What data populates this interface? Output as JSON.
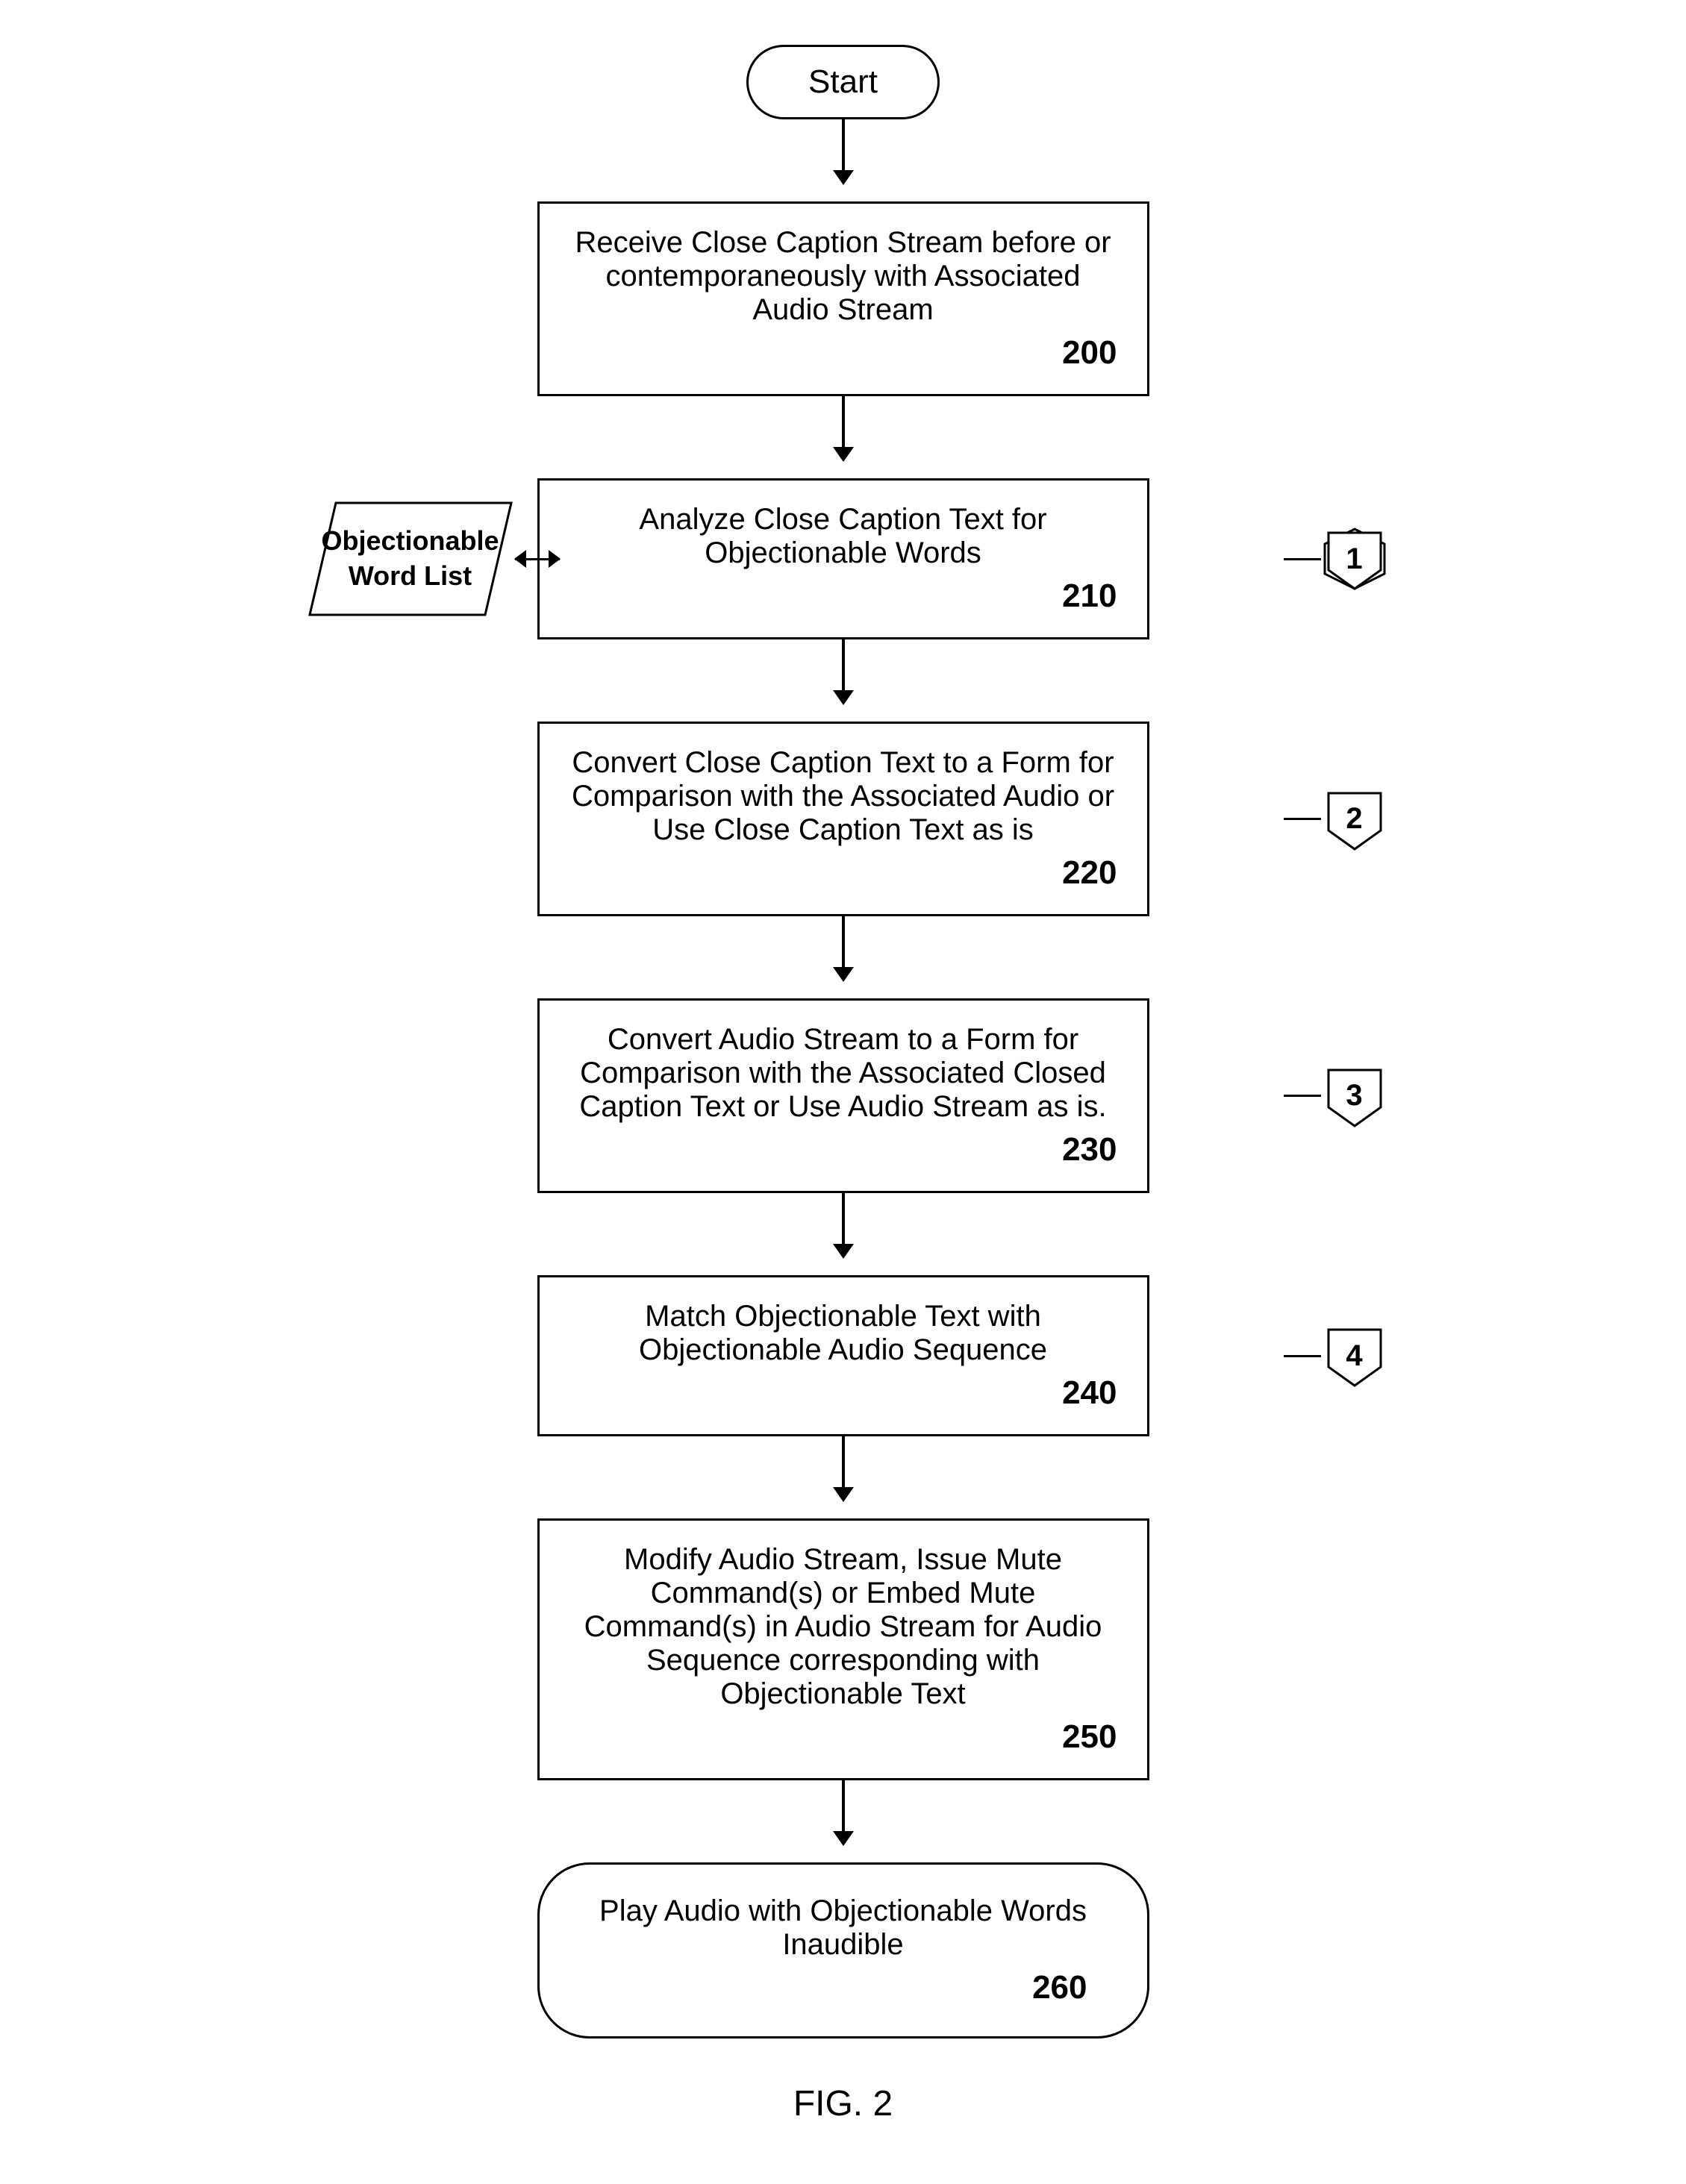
{
  "diagram": {
    "title": "FIG. 2",
    "start_label": "Start",
    "steps": [
      {
        "id": "200",
        "text": "Receive Close Caption Stream before or contemporaneously with Associated Audio Stream",
        "num": "200",
        "shape": "rect",
        "side": null
      },
      {
        "id": "210",
        "text": "Analyze Close Caption Text for Objectionable Words",
        "num": "210",
        "shape": "rect",
        "side": "1",
        "left_shape": true
      },
      {
        "id": "220",
        "text": "Convert Close Caption Text to a Form for Comparison with the Associated Audio or Use Close Caption Text as is",
        "num": "220",
        "shape": "rect",
        "side": "2"
      },
      {
        "id": "230",
        "text": "Convert Audio Stream to a Form for Comparison with the Associated Closed Caption Text or Use Audio Stream as is.",
        "num": "230",
        "shape": "rect",
        "side": "3"
      },
      {
        "id": "240",
        "text": "Match Objectionable Text with Objectionable Audio Sequence",
        "num": "240",
        "shape": "rect",
        "side": "4"
      },
      {
        "id": "250",
        "text": "Modify Audio Stream, Issue Mute Command(s) or Embed Mute Command(s) in Audio Stream for Audio Sequence corresponding with Objectionable Text",
        "num": "250",
        "shape": "rect",
        "side": null
      }
    ],
    "end": {
      "text": "Play Audio with Objectionable Words Inaudible",
      "num": "260",
      "shape": "rounded-rect"
    },
    "left_label": "Objectionable\nWord List"
  }
}
